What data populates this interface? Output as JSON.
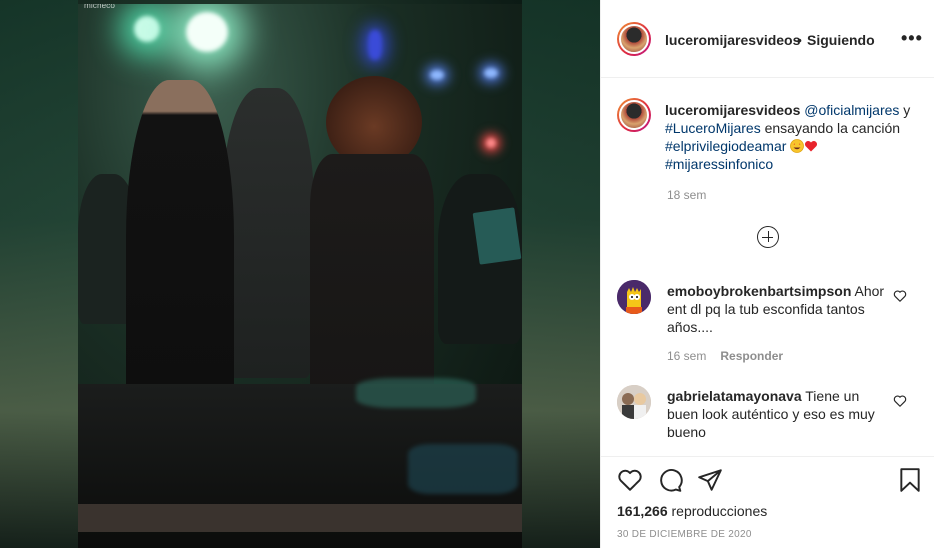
{
  "media": {
    "watermark": "ᵐᶦᶜʰᵉᶜᵒ"
  },
  "header": {
    "username": "luceromijaresvideos",
    "separator": "•",
    "follow_status": "Siguiendo",
    "more_icon": "more-horizontal-icon"
  },
  "caption": {
    "username": "luceromijaresvideos",
    "mention": "@oficialmijares",
    "text_1": " y ",
    "hashtag_1": "#LuceroMijares",
    "text_2": " ensayando la canción ",
    "hashtag_2": "#elprivilegiodeamar",
    "hashtag_3": "#mijaressinfonico",
    "emoji_1": "star-struck-emoji",
    "emoji_2": "red-heart-emoji",
    "time": "18 sem"
  },
  "load_more_icon": "plus-circle-icon",
  "comments": [
    {
      "username": "emoboybrokenbartsimpson",
      "text": "Ahor ent dl pq la tub esconfida tantos años....",
      "time": "16 sem",
      "reply_label": "Responder",
      "avatar_icon": "bart-simpson-avatar"
    },
    {
      "username": "gabrielatamayonava",
      "text": "Tiene un buen look auténtico y eso es muy bueno",
      "avatar_icon": "user-photo-avatar"
    }
  ],
  "actions": {
    "like_icon": "heart-icon",
    "comment_icon": "comment-icon",
    "share_icon": "paper-plane-icon",
    "save_icon": "bookmark-icon",
    "views_count": "161,266",
    "views_label": "reproducciones",
    "date": "30 DE DICIEMBRE DE 2020"
  },
  "colors": {
    "link": "#00376b",
    "text": "#262626",
    "muted": "#8e8e8e",
    "border": "#efefef"
  }
}
